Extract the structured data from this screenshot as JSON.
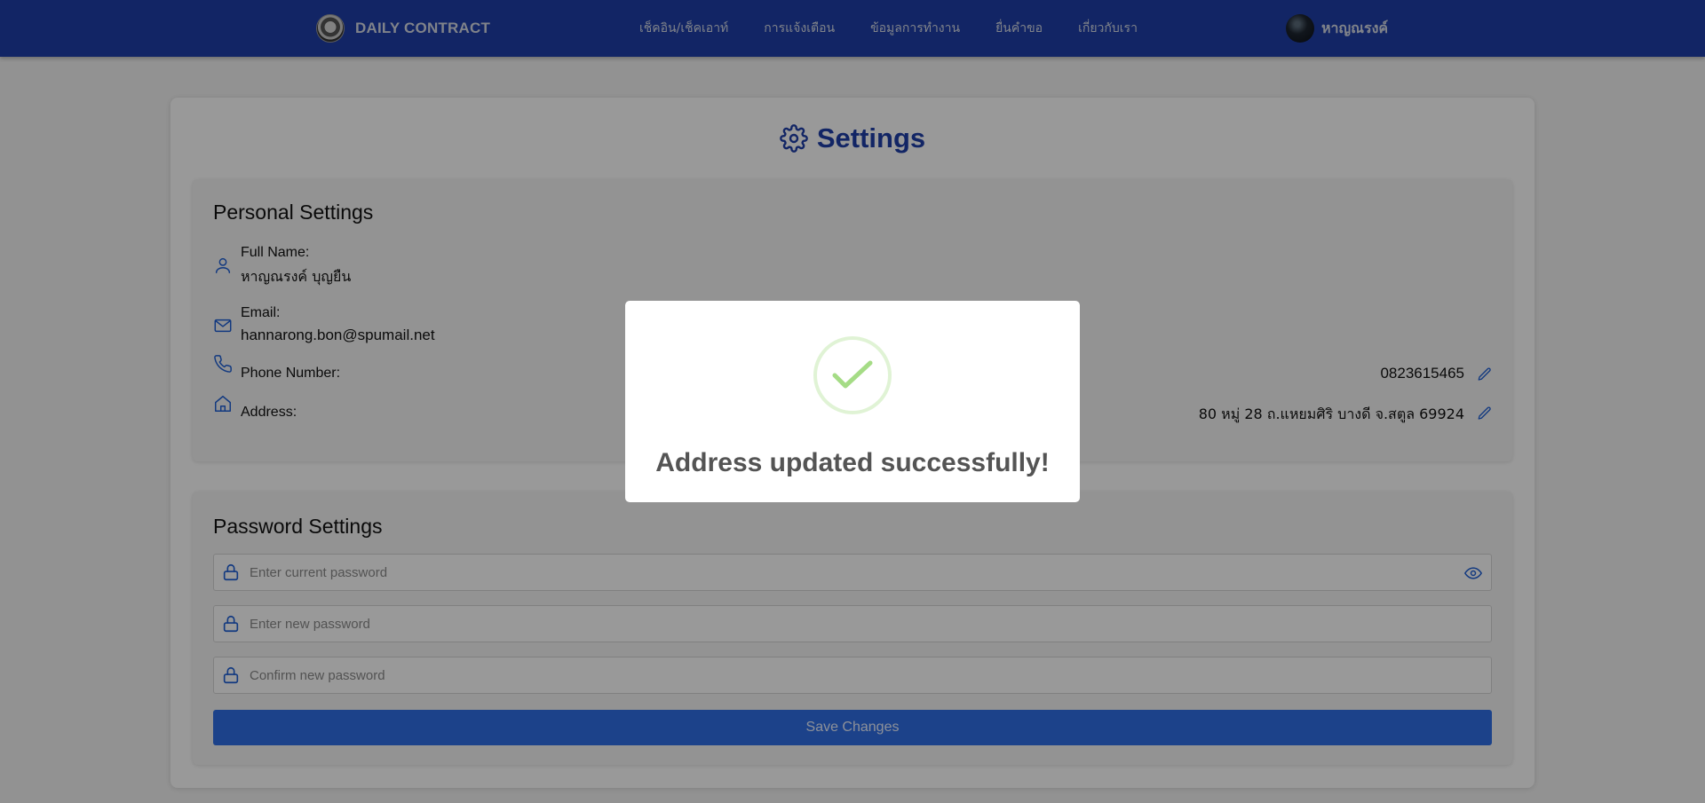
{
  "navbar": {
    "brand": "DAILY CONTRACT",
    "links": [
      "เช็คอิน/เช็คเอาท์",
      "การแจ้งเตือน",
      "ข้อมูลการทำงาน",
      "ยื่นคำขอ",
      "เกี่ยวกับเรา"
    ],
    "user_name": "หาญณรงค์",
    "colors": {
      "background": "#1e3fa8",
      "text": "#d6dbe6"
    }
  },
  "page": {
    "title": "Settings",
    "title_icon": "gear-icon",
    "accent_color": "#1e3fa8"
  },
  "personal": {
    "heading": "Personal Settings",
    "full_name_label": "Full Name:",
    "full_name": "หาญณรงค์ บุญยืน",
    "email_label": "Email:",
    "email": "hannarong.bon@spumail.net",
    "phone_label": "Phone Number:",
    "phone": "0823615465",
    "address_label": "Address:",
    "address": "80 หมู่ 28 ถ.แหยมศิริ บางดี จ.สตูล 69924"
  },
  "password": {
    "heading": "Password Settings",
    "current_placeholder": "Enter current password",
    "new_placeholder": "Enter new password",
    "confirm_placeholder": "Confirm new password",
    "save_label": "Save Changes",
    "button_color": "#2f6fe6"
  },
  "modal": {
    "message": "Address updated successfully!",
    "icon": "check-circle-icon",
    "icon_color": "#a5dc86"
  }
}
